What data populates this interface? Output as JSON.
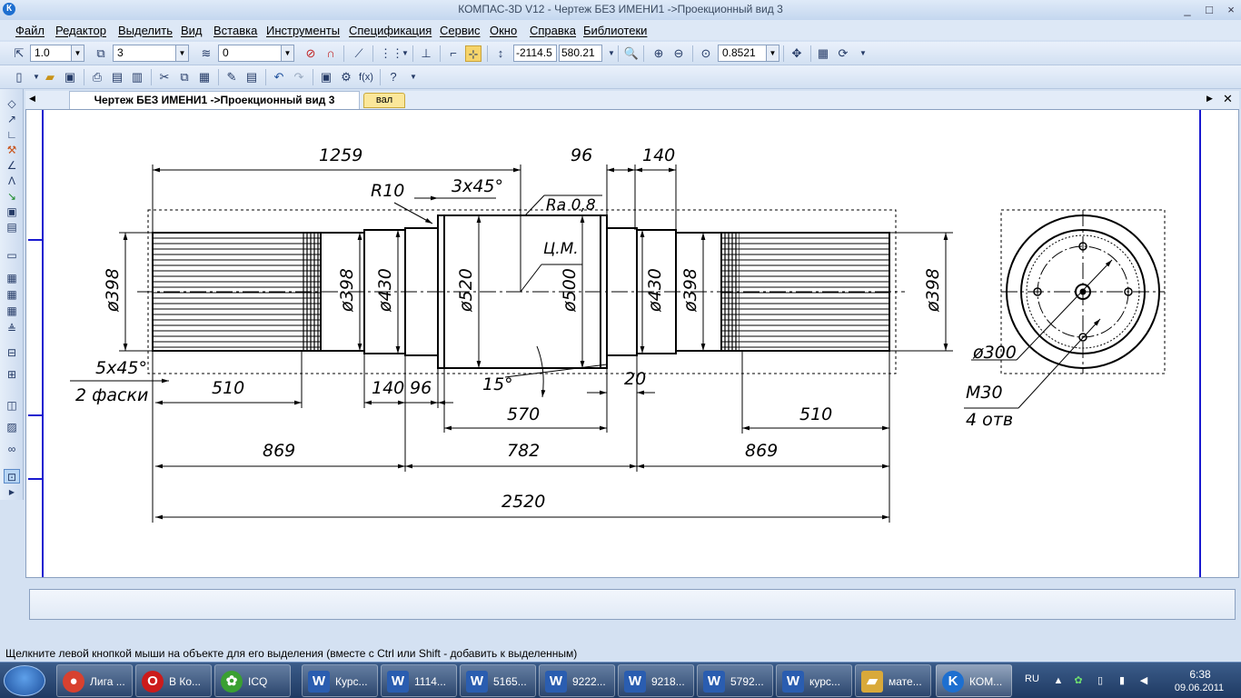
{
  "window": {
    "title": "КОМПАС-3D V12 - Чертеж БЕЗ ИМЕНИ1 ->Проекционный вид 3",
    "app_icon": "kompas-logo-icon",
    "controls": [
      "_",
      "□",
      "×"
    ]
  },
  "menu": [
    "Файл",
    "Редактор",
    "Выделить",
    "Вид",
    "Вставка",
    "Инструменты",
    "Спецификация",
    "Сервис",
    "Окно",
    "Справка",
    "Библиотеки"
  ],
  "toolbar1": {
    "scale": "1.0",
    "layer": "3",
    "style": "0",
    "coord_x": "-2114.5",
    "coord_y": "580.21",
    "zoom": "0.8521"
  },
  "tabs": {
    "document": "Чертеж БЕЗ ИМЕНИ1 ->Проекционный вид 3",
    "second": "вал"
  },
  "drawing": {
    "dims": {
      "d1259": "1259",
      "d96top": "96",
      "d140top": "140",
      "r10": "R10",
      "chamfer_top": "3x45°",
      "roughness": "Ra 0,8",
      "center": "Ц.М.",
      "dia398_left": "ø398",
      "dia398_a": "ø398",
      "dia430_a": "ø430",
      "dia520": "ø520",
      "dia500": "ø500",
      "dia430_b": "ø430",
      "dia398_b": "ø398",
      "dia398_right": "ø398",
      "chamfer_left": "5x45°",
      "two_chamfers": "2 фаски",
      "d510_left": "510",
      "d140_bottom": "140",
      "d96_bottom": "96",
      "angle15": "15°",
      "d20": "20",
      "d570": "570",
      "d510_right": "510",
      "d869_left": "869",
      "d782": "782",
      "d869_right": "869",
      "d2520": "2520",
      "dia300": "ø300",
      "m30": "M30",
      "holes": "4 отв"
    }
  },
  "status_hint": "Щелкните левой кнопкой мыши на объекте для его выделения (вместе с Ctrl или Shift - добавить к выделенным)",
  "taskbar": {
    "items": [
      {
        "label": "Лига ...",
        "icon": "chrome-icon",
        "color": "#d8412f"
      },
      {
        "label": "В Ко...",
        "icon": "opera-icon",
        "color": "#cc1b1b"
      },
      {
        "label": "ICQ",
        "icon": "icq-icon",
        "color": "#3aa032"
      },
      {
        "label": "Курс...",
        "icon": "word-icon",
        "color": "#2a5db0"
      },
      {
        "label": "1114...",
        "icon": "word-icon",
        "color": "#2a5db0"
      },
      {
        "label": "5165...",
        "icon": "word-icon",
        "color": "#2a5db0"
      },
      {
        "label": "9222...",
        "icon": "word-icon",
        "color": "#2a5db0"
      },
      {
        "label": "9218...",
        "icon": "word-icon",
        "color": "#2a5db0"
      },
      {
        "label": "5792...",
        "icon": "word-icon",
        "color": "#2a5db0"
      },
      {
        "label": "курс...",
        "icon": "word-icon",
        "color": "#2a5db0"
      },
      {
        "label": "мате...",
        "icon": "folder-icon",
        "color": "#d9a93a"
      },
      {
        "label": "КОМ...",
        "icon": "kompas-icon",
        "color": "#1d6fd0"
      }
    ],
    "lang": "RU",
    "time": "6:38",
    "date": "09.06.2011"
  }
}
